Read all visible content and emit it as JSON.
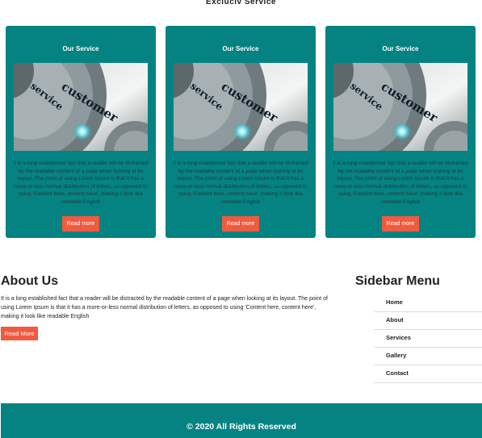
{
  "page": {
    "heading": "Excluciv Service"
  },
  "cards": [
    {
      "title": "Our Service",
      "image_alt": "customer service",
      "image_word_1": "customer",
      "image_word_2": "service",
      "text": "It is a long established fact that a reader will be distracted by the readable content of a page when looking at its layout. The point of using Lorem Ipsum is that it has a more-or-less normal distribution of letters, as opposed to using 'Content here, content here', making it look like readable English",
      "button_label": "Read more"
    },
    {
      "title": "Our Service",
      "image_alt": "customer service",
      "image_word_1": "customer",
      "image_word_2": "service",
      "text": "It is a long established fact that a reader will be distracted by the readable content of a page when looking at its layout. The point of using Lorem Ipsum is that it has a more-or-less normal distribution of letters, as opposed to using 'Content here, content here', making it look like readable English",
      "button_label": "Read more"
    },
    {
      "title": "Our Service",
      "image_alt": "customer service",
      "image_word_1": "customer",
      "image_word_2": "service",
      "text": "It is a long established fact that a reader will be distracted by the readable content of a page when looking at its layout. The point of using Lorem Ipsum is that it has a more-or-less normal distribution of letters, as opposed to using 'Content here, content here', making it look like readable English",
      "button_label": "Read more"
    }
  ],
  "about": {
    "title": "About Us",
    "text": "It is a long established fact that a reader will be distracted by the readable content of a page when looking at its layout. The point of using Lorem Ipsum is that it has a more-or-less normal distribution of letters, as opposed to using 'Content here, content here', making it look like readable English",
    "button_label": "Read More"
  },
  "sidebar": {
    "title": "Sidebar Menu",
    "items": [
      {
        "label": "Home"
      },
      {
        "label": "About"
      },
      {
        "label": "Services"
      },
      {
        "label": "Gallery"
      },
      {
        "label": "Contact"
      }
    ]
  },
  "footer": {
    "text": "© 2020 All Rights Reserved"
  },
  "colors": {
    "teal": "#058383",
    "button": "#f05a41",
    "background": "#ffffff"
  }
}
